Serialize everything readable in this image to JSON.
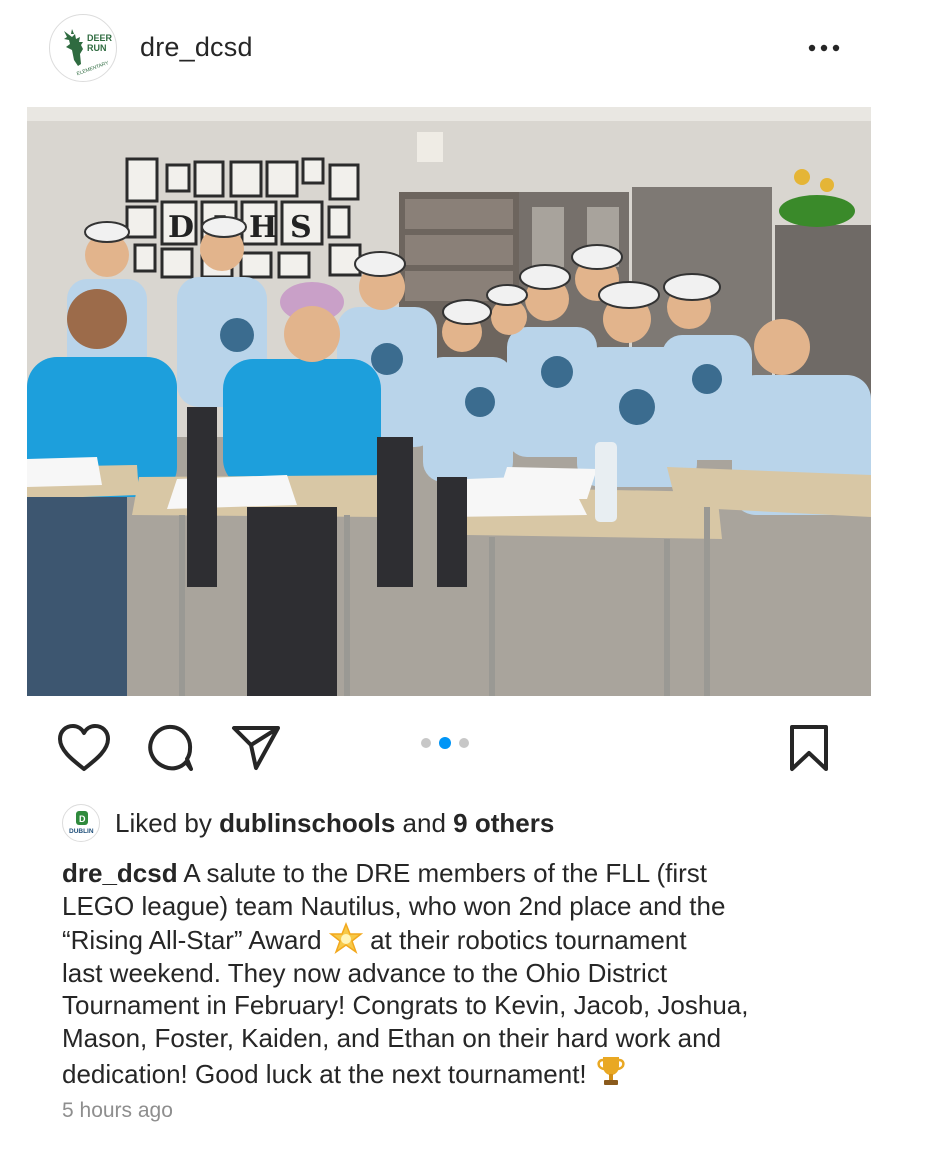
{
  "header": {
    "username": "dre_dcsd",
    "avatar_logo_text": [
      "DEER",
      "RUN",
      "ELEMENTARY"
    ],
    "more_icon": "more-horizontal-icon"
  },
  "post": {
    "image_description_icon": "classroom-team-photo",
    "carousel": {
      "count": 3,
      "active_index": 1
    }
  },
  "actions": {
    "like_icon": "heart-icon",
    "comment_icon": "comment-icon",
    "share_icon": "send-icon",
    "save_icon": "bookmark-icon"
  },
  "likes": {
    "avatar_logo_text": "DUBLIN",
    "prefix": "Liked by ",
    "user": "dublinschools",
    "middle": " and ",
    "others": "9 others"
  },
  "caption": {
    "user": "dre_dcsd",
    "lines": [
      " A salute to the DRE members of the FLL (first",
      "LEGO league) team Nautilus, who won 2nd place and the",
      "“Rising All-Star” Award ",
      " at their robotics tournament",
      "last weekend. They now advance to the Ohio District",
      "Tournament in February! Congrats to Kevin, Jacob, Joshua,",
      "Mason, Foster, Kaiden, and Ethan on their hard work and",
      "dedication! Good luck at the next tournament! "
    ],
    "star_emoji_icon": "glowing-star-icon",
    "trophy_emoji_icon": "trophy-icon"
  },
  "timestamp": "5 hours ago",
  "colors": {
    "accent": "#0095f6",
    "text": "#262626",
    "muted": "#8e8e8e",
    "shirt_blue": "#1d9fdc",
    "shirt_light": "#b9d4ea"
  }
}
